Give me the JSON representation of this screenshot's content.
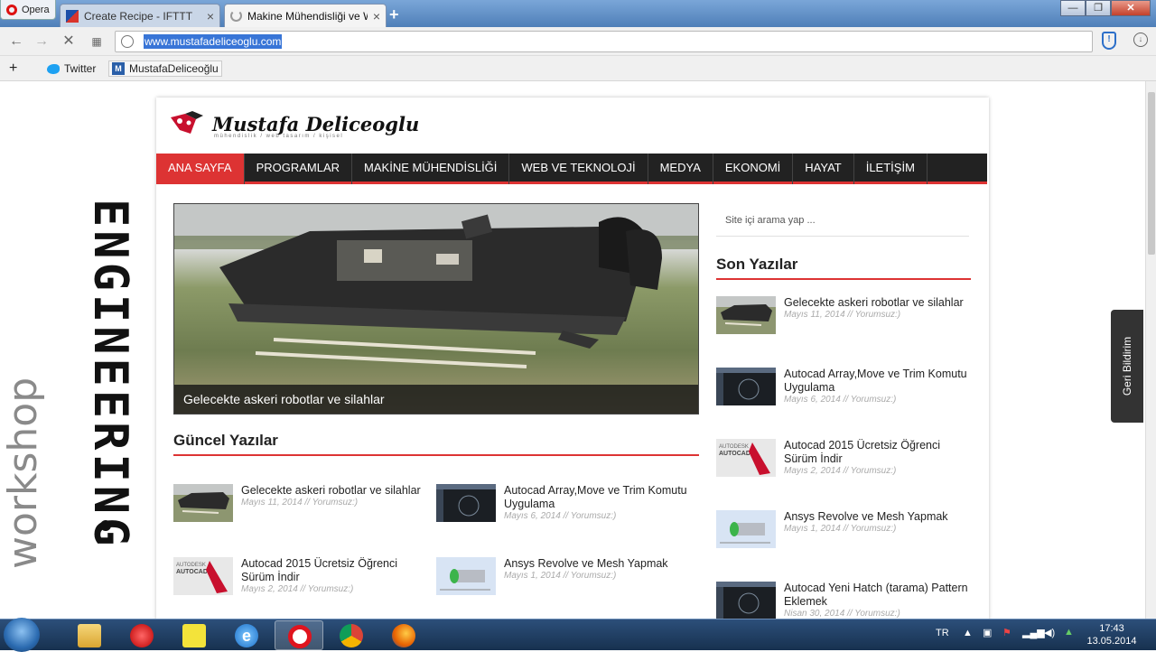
{
  "browser": {
    "app_button": "Opera",
    "tabs": [
      {
        "title": "Create Recipe - IFTTT",
        "active": false
      },
      {
        "title": "Makine Mühendisliği ve W",
        "active": true
      }
    ],
    "new_tab": "+",
    "url": "www.mustafadeliceoglu.com",
    "bookmarks_add": "+",
    "bookmarks": [
      "Twitter",
      "MustafaDeliceoğlu"
    ]
  },
  "site": {
    "logo_text": "Mustafa Deliceoglu",
    "logo_tagline": "mühendislik / web tasarım / kişisel",
    "menu": [
      {
        "label": "ANA SAYFA",
        "active": true
      },
      {
        "label": "PROGRAMLAR",
        "active": false
      },
      {
        "label": "MAKİNE MÜHENDİSLİĞİ",
        "active": false
      },
      {
        "label": "WEB VE TEKNOLOJİ",
        "active": false
      },
      {
        "label": "MEDYA",
        "active": false
      },
      {
        "label": "EKONOMİ",
        "active": false
      },
      {
        "label": "HAYAT",
        "active": false
      },
      {
        "label": "İLETİŞİM",
        "active": false
      }
    ],
    "hero_caption": "Gelecekte askeri robotlar ve silahlar",
    "search_placeholder": "Site içi arama yap ...",
    "current_title": "Güncel Yazılar",
    "current_posts": [
      {
        "title": "Gelecekte askeri robotlar ve silahlar",
        "meta": "Mayıs 11, 2014 // Yorumsuz:)",
        "thumb": "vehicle"
      },
      {
        "title": "Autocad Array,Move ve Trim Komutu Uygulama",
        "meta": "Mayıs 6, 2014 // Yorumsuz:)",
        "thumb": "cad-dark"
      },
      {
        "title": "Autocad 2015 Ücretsiz Öğrenci Sürüm İndir",
        "meta": "Mayıs 2, 2014 // Yorumsuz:)",
        "thumb": "autocad-box"
      },
      {
        "title": "Ansys Revolve ve Mesh Yapmak",
        "meta": "Mayıs 1, 2014 // Yorumsuz:)",
        "thumb": "ansys"
      }
    ],
    "recent_title": "Son Yazılar",
    "recent_posts": [
      {
        "title": "Gelecekte askeri robotlar ve silahlar",
        "meta": "Mayıs 11, 2014 // Yorumsuz:)",
        "thumb": "vehicle"
      },
      {
        "title": "Autocad Array,Move ve Trim Komutu Uygulama",
        "meta": "Mayıs 6, 2014 // Yorumsuz:)",
        "thumb": "cad-dark"
      },
      {
        "title": "Autocad 2015 Ücretsiz Öğrenci Sürüm İndir",
        "meta": "Mayıs 2, 2014 // Yorumsuz:)",
        "thumb": "autocad-box"
      },
      {
        "title": "Ansys Revolve ve Mesh Yapmak",
        "meta": "Mayıs 1, 2014 // Yorumsuz:)",
        "thumb": "ansys"
      },
      {
        "title": "Autocad Yeni Hatch (tarama) Pattern Eklemek",
        "meta": "Nisan 30, 2014 // Yorumsuz:)",
        "thumb": "cad-dark"
      }
    ],
    "feedback": "Geri Bildirim",
    "thumb_autocad_text": "AUTODESK AUTOCAD 2015"
  },
  "overlay": {
    "brand_vertical": "ENGINEERING",
    "brand_sub": "workshop"
  },
  "taskbar": {
    "language": "TR",
    "time": "17:43",
    "date": "13.05.2014"
  },
  "colors": {
    "accent": "#dd3333",
    "menu_bg": "#222222"
  }
}
